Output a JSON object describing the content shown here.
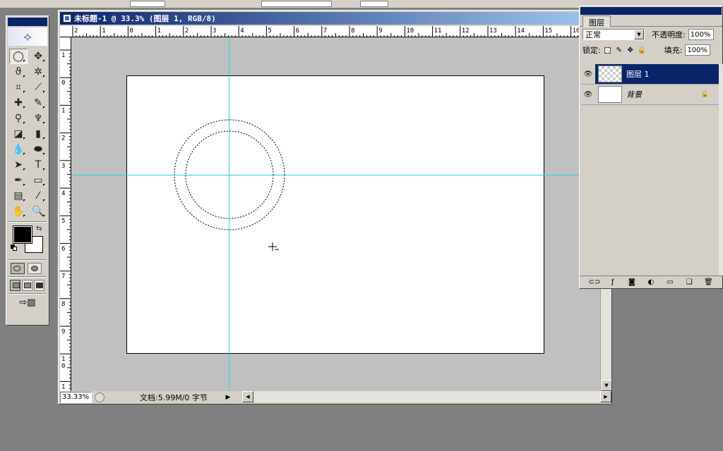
{
  "document": {
    "title": "未标题-1 @ 33.3% (图层 1, RGB/8)",
    "zoom": "33.33%",
    "doc_info": "文档:5.99M/0 字节",
    "ruler_h_labels": [
      "2",
      "1",
      "0",
      "1",
      "2",
      "3",
      "4",
      "5",
      "6",
      "7",
      "8",
      "9",
      "10",
      "11",
      "12",
      "13",
      "14",
      "15",
      "16"
    ],
    "ruler_v_labels": [
      "1",
      "0",
      "1",
      "2",
      "3",
      "4",
      "5",
      "6",
      "7",
      "8",
      "9",
      "1 0",
      "1"
    ]
  },
  "toolbox": {
    "tools": [
      {
        "name": "elliptical-marquee-tool-icon",
        "glyph": "◯",
        "active": true
      },
      {
        "name": "move-tool-icon",
        "glyph": "✥"
      },
      {
        "name": "lasso-tool-icon",
        "glyph": "ϑ"
      },
      {
        "name": "magic-wand-tool-icon",
        "glyph": "✲"
      },
      {
        "name": "crop-tool-icon",
        "glyph": "⌗"
      },
      {
        "name": "slice-tool-icon",
        "glyph": "⟋"
      },
      {
        "name": "healing-brush-icon",
        "glyph": "✚"
      },
      {
        "name": "brush-tool-icon",
        "glyph": "✎"
      },
      {
        "name": "clone-stamp-icon",
        "glyph": "⚲"
      },
      {
        "name": "history-brush-icon",
        "glyph": "♆"
      },
      {
        "name": "eraser-tool-icon",
        "glyph": "◪"
      },
      {
        "name": "gradient-tool-icon",
        "glyph": "▮"
      },
      {
        "name": "blur-tool-icon",
        "glyph": "💧"
      },
      {
        "name": "dodge-tool-icon",
        "glyph": "⬬"
      },
      {
        "name": "path-selection-icon",
        "glyph": "➤"
      },
      {
        "name": "type-tool-icon",
        "glyph": "T"
      },
      {
        "name": "pen-tool-icon",
        "glyph": "✒"
      },
      {
        "name": "rectangle-tool-icon",
        "glyph": "▭"
      },
      {
        "name": "notes-tool-icon",
        "glyph": "▤"
      },
      {
        "name": "eyedropper-tool-icon",
        "glyph": "⁄"
      },
      {
        "name": "hand-tool-icon",
        "glyph": "✋"
      },
      {
        "name": "zoom-tool-icon",
        "glyph": "🔍"
      }
    ],
    "colors": {
      "foreground": "#000000",
      "background": "#ffffff"
    }
  },
  "layers_panel": {
    "tab": "图层",
    "blend_mode": "正常",
    "opacity_label": "不透明度:",
    "opacity_value": "100%",
    "lock_label": "锁定:",
    "fill_label": "填充:",
    "fill_value": "100%",
    "layers": [
      {
        "name": "图层 1",
        "active": true,
        "thumb": "transparent"
      },
      {
        "name": "背景",
        "active": false,
        "thumb": "white",
        "locked": true
      }
    ]
  },
  "colors": {
    "title_blue": "#0a246a",
    "guide_cyan": "#2fd0e0",
    "panel_gray": "#d4d0c8",
    "workspace_gray": "#808080",
    "canvas_gray": "#c0c0c0"
  }
}
